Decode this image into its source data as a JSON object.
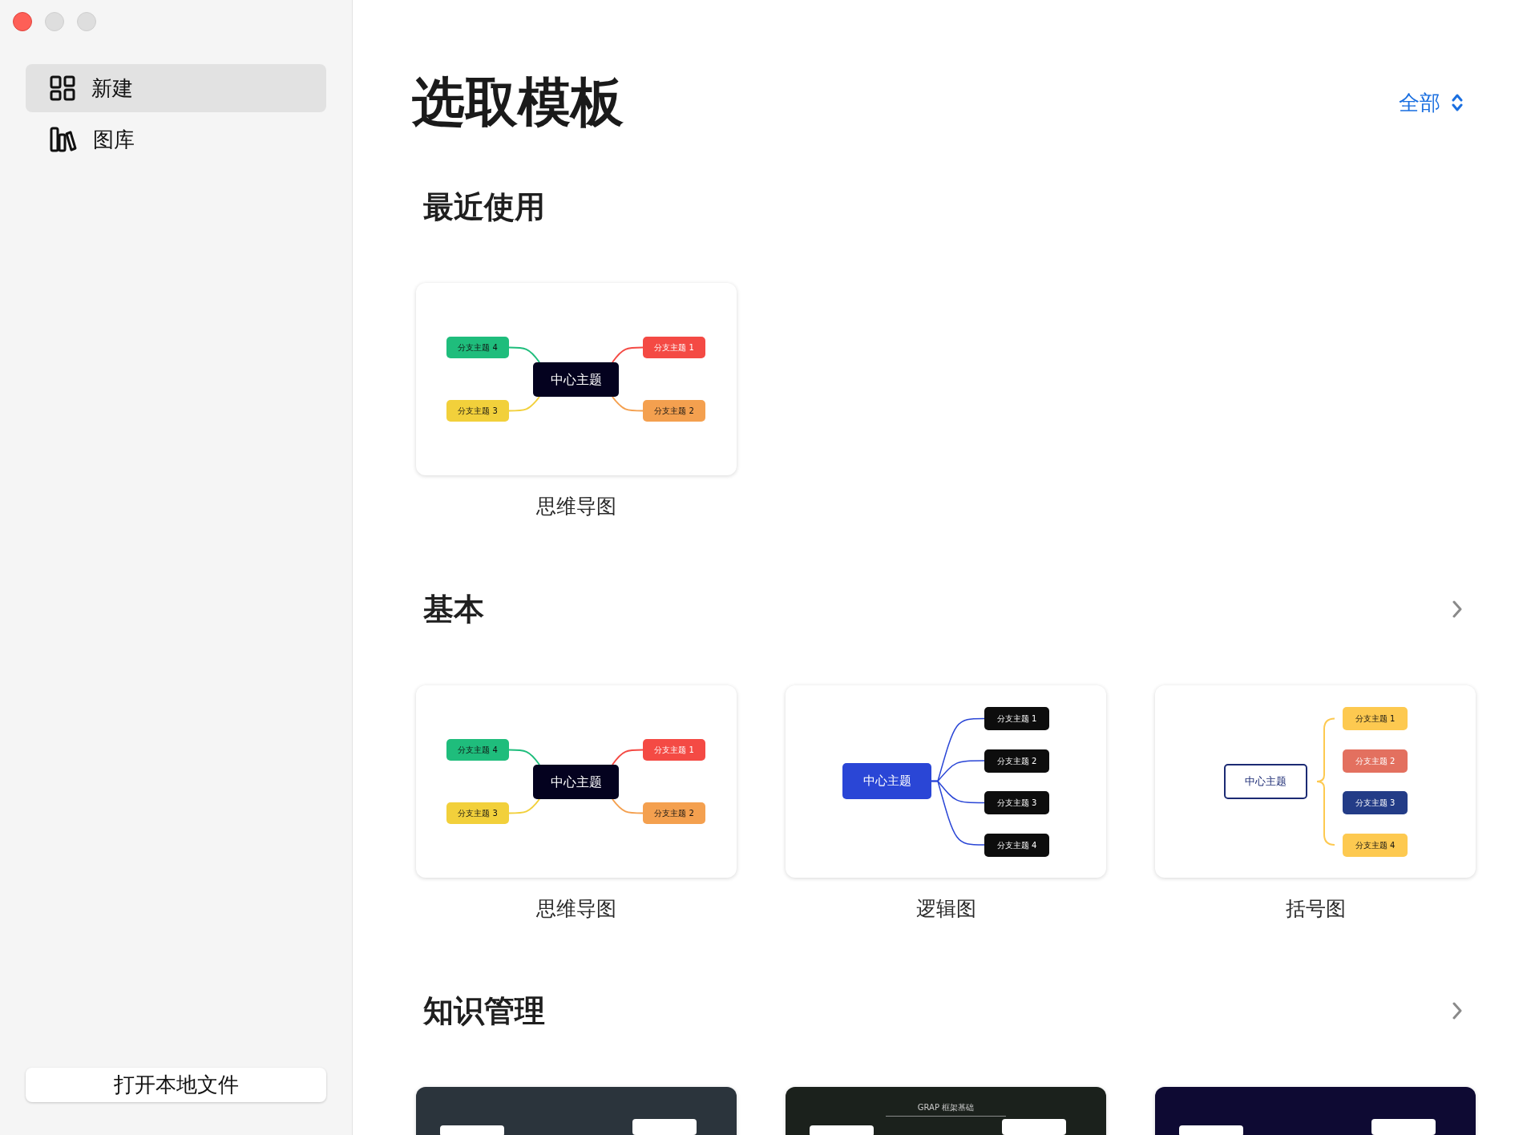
{
  "sidebar": {
    "items": [
      {
        "label": "新建",
        "selected": true
      },
      {
        "label": "图库",
        "selected": false
      }
    ],
    "open_button": "打开本地文件"
  },
  "main": {
    "title": "选取模板",
    "filter": "全部",
    "sections": [
      {
        "title": "最近使用",
        "has_more": false,
        "templates": [
          {
            "kind": "mindmap",
            "label": "思维导图",
            "center": "中心主题",
            "branches": [
              {
                "text": "分支主题 4",
                "color": "#1fbd7c"
              },
              {
                "text": "分支主题 1",
                "color": "#f44a44"
              },
              {
                "text": "分支主题 3",
                "color": "#f2d03b"
              },
              {
                "text": "分支主题 2",
                "color": "#f4a04f"
              }
            ]
          }
        ]
      },
      {
        "title": "基本",
        "has_more": true,
        "templates": [
          {
            "kind": "mindmap",
            "label": "思维导图",
            "center": "中心主题",
            "branches": [
              {
                "text": "分支主题 4",
                "color": "#1fbd7c"
              },
              {
                "text": "分支主题 1",
                "color": "#f44a44"
              },
              {
                "text": "分支主题 3",
                "color": "#f2d03b"
              },
              {
                "text": "分支主题 2",
                "color": "#f4a04f"
              }
            ]
          },
          {
            "kind": "logic",
            "label": "逻辑图",
            "center": "中心主题",
            "branches": [
              {
                "text": "分支主题 1",
                "color": "#0d0d0d"
              },
              {
                "text": "分支主题 2",
                "color": "#0d0d0d"
              },
              {
                "text": "分支主题 3",
                "color": "#0d0d0d"
              },
              {
                "text": "分支主题 4",
                "color": "#0d0d0d"
              }
            ]
          },
          {
            "kind": "bracket",
            "label": "括号图",
            "center": "中心主题",
            "branches": [
              {
                "text": "分支主题 1",
                "color": "#fdc950"
              },
              {
                "text": "分支主题 2",
                "color": "#e3705f"
              },
              {
                "text": "分支主题 3",
                "color": "#233c87"
              },
              {
                "text": "分支主题 4",
                "color": "#fdc950"
              }
            ]
          }
        ]
      },
      {
        "title": "知识管理",
        "has_more": true,
        "templates": [
          {
            "kind": "preview",
            "color": "#2b343c"
          },
          {
            "kind": "preview",
            "color": "#1b211c",
            "heading": "GRAP 框架基础"
          },
          {
            "kind": "preview",
            "color": "#0e0a33"
          }
        ]
      }
    ]
  }
}
